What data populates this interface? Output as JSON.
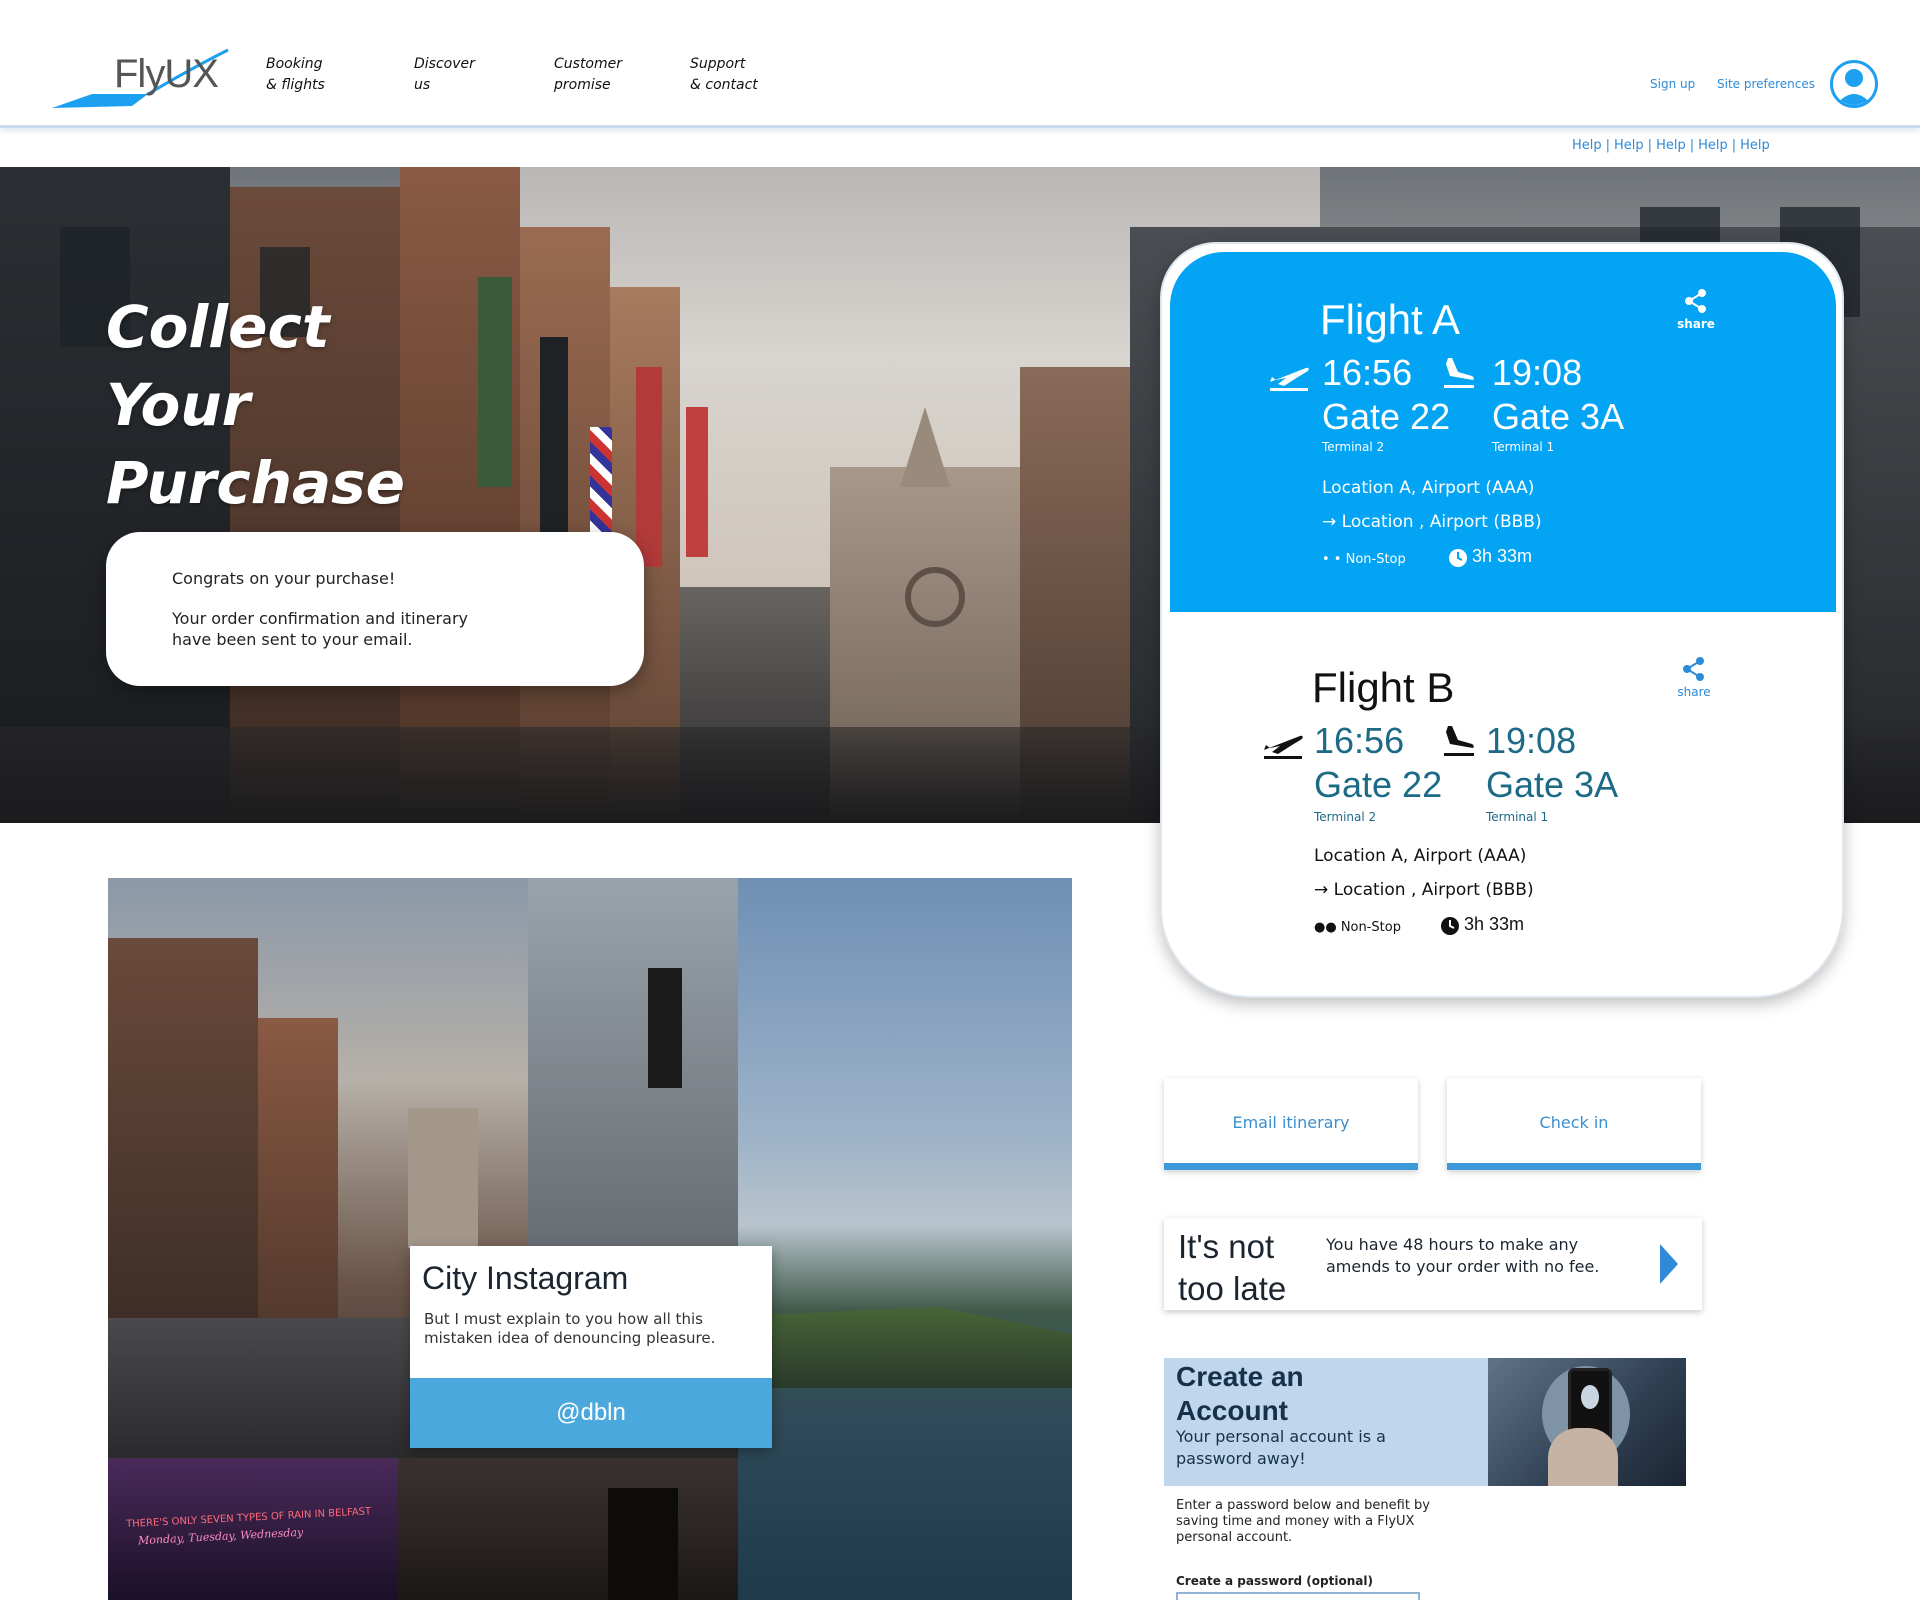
{
  "brand": {
    "name": "FlyUX",
    "accent": "#03a4f4",
    "link_color": "#2d8bd8"
  },
  "nav": [
    {
      "line1": "Booking",
      "line2": "& flights"
    },
    {
      "line1": "Discover",
      "line2": "us"
    },
    {
      "line1": "Customer",
      "line2": "promise"
    },
    {
      "line1": "Support",
      "line2": "& contact"
    }
  ],
  "header_links": {
    "signup": "Sign up",
    "preferences": "Site preferences"
  },
  "help_links": [
    "Help",
    "Help",
    "Help",
    "Help",
    "Help"
  ],
  "help_separator": "|",
  "hero": {
    "title_lines": [
      "Collect",
      "Your",
      "Purchase"
    ],
    "congrats": "Congrats on your purchase!",
    "confirmation_line1": "Your order confirmation and itinerary",
    "confirmation_line2": "have been sent to your email."
  },
  "flights": [
    {
      "title": "Flight A",
      "share": "share",
      "depart_time": "16:56",
      "arrive_time": "19:08",
      "depart_gate": "Gate 22",
      "arrive_gate": "Gate 3A",
      "depart_terminal": "Terminal 2",
      "arrive_terminal": "Terminal 1",
      "origin": "Location A, Airport (AAA)",
      "destination": "→ Location , Airport (BBB)",
      "stops": "• • Non-Stop",
      "duration": "3h 33m"
    },
    {
      "title": "Flight B",
      "share": "share",
      "depart_time": "16:56",
      "arrive_time": "19:08",
      "depart_gate": "Gate 22",
      "arrive_gate": "Gate 3A",
      "depart_terminal": "Terminal 2",
      "arrive_terminal": "Terminal 1",
      "origin": "Location A, Airport (AAA)",
      "destination": "→ Location , Airport (BBB)",
      "stops": "●● Non-Stop",
      "duration": "3h 33m"
    }
  ],
  "actions": {
    "email": "Email itinerary",
    "checkin": "Check in"
  },
  "late": {
    "line1": "It's not",
    "line2": "too late",
    "text": "You have 48 hours to make any amends to your order with no fee."
  },
  "account": {
    "title_line1": "Create an",
    "title_line2": "Account",
    "subtitle": "Your personal account is a password away!",
    "description": "Enter a password below and benefit by saving time and money with a FlyUX personal account.",
    "password_label": "Create a password (optional)"
  },
  "collage": {
    "title": "City Instagram",
    "text": "But I must explain to you how all this mistaken idea of denouncing pleasure.",
    "handle": "@dbln",
    "neon_line1": "THERE'S ONLY SEVEN TYPES OF RAIN IN BELFAST",
    "neon_line2": "Monday, Tuesday, Wednesday"
  }
}
